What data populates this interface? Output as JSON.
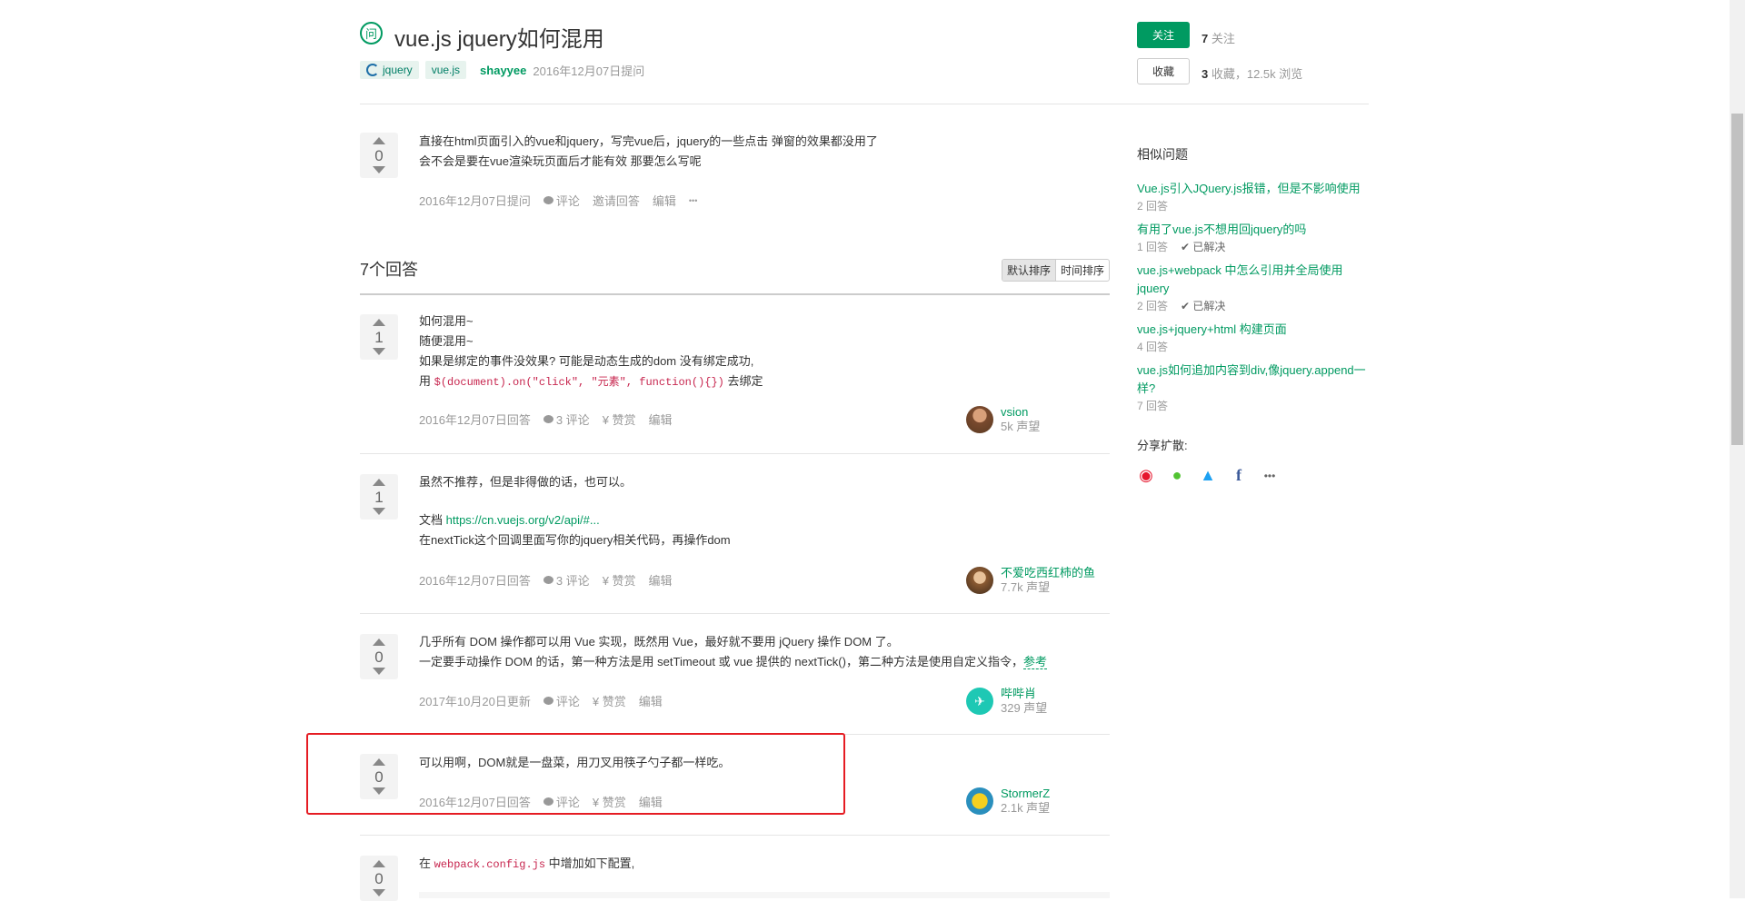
{
  "question": {
    "icon_text": "问",
    "title": "vue.js jquery如何混用",
    "tags": [
      "jquery",
      "vue.js"
    ],
    "author": "shayyee",
    "asked_time": "2016年12月07日提问",
    "follow_label": "关注",
    "follow_count": "7",
    "follow_suffix": " 关注",
    "collect_label": "收藏",
    "collect_count": "3",
    "collect_suffix": " 收藏，12.5k 浏览",
    "votes": "0",
    "body_line1": "直接在html页面引入的vue和jquery，写完vue后，jquery的一些点击 弹窗的效果都没用了",
    "body_line2": "会不会是要在vue渲染玩页面后才能有效 那要怎么写呢",
    "action_time": "2016年12月07日提问",
    "action_comment": "评论",
    "action_invite": "邀请回答",
    "action_edit": "编辑",
    "action_more": "•••"
  },
  "answers_header": {
    "title": "7个回答",
    "sort_default": "默认排序",
    "sort_time": "时间排序"
  },
  "answers": [
    {
      "votes": "1",
      "line1": "如何混用~",
      "line2": "随便混用~",
      "line3": "如果是绑定的事件没效果? 可能是动态生成的dom 没有绑定成功,",
      "line4_prefix": "用 ",
      "line4_code": "$(document).on(\"click\", \"元素\", function(){})",
      "line4_suffix": " 去绑定",
      "time": "2016年12月07日回答",
      "comments": "3 评论",
      "reward": "¥ 赞赏",
      "edit": "编辑",
      "user": "vsion",
      "rep": "5k 声望"
    },
    {
      "votes": "1",
      "line1": "虽然不推荐，但是非得做的话，也可以。",
      "line2_prefix": "文档 ",
      "line2_link": "https://cn.vuejs.org/v2/api/#...",
      "line3": "在nextTick这个回调里面写你的jquery相关代码，再操作dom",
      "time": "2016年12月07日回答",
      "comments": "3 评论",
      "reward": "¥ 赞赏",
      "edit": "编辑",
      "user": "不爱吃西红柿的鱼",
      "rep": "7.7k 声望"
    },
    {
      "votes": "0",
      "line1": "几乎所有 DOM 操作都可以用 Vue 实现，既然用 Vue，最好就不要用 jQuery 操作 DOM 了。",
      "line2": "一定要手动操作 DOM 的话，第一种方法是用 setTimeout 或 vue 提供的 nextTick()，第二种方法是使用自定义指令，",
      "line2_link": "参考",
      "time": "2017年10月20日更新",
      "comments": "评论",
      "reward": "¥ 赞赏",
      "edit": "编辑",
      "user": "哔哔肖",
      "rep": "329 声望"
    },
    {
      "votes": "0",
      "line1": "可以用啊，DOM就是一盘菜，用刀叉用筷子勺子都一样吃。",
      "time": "2016年12月07日回答",
      "comments": "评论",
      "reward": "¥ 赞赏",
      "edit": "编辑",
      "user": "StormerZ",
      "rep": "2.1k 声望"
    },
    {
      "votes": "0",
      "line1_prefix": "在 ",
      "line1_code": "webpack.config.js",
      "line1_suffix": " 中增加如下配置,"
    }
  ],
  "sidebar": {
    "similar_title": "相似问题",
    "similar": [
      {
        "title": "Vue.js引入JQuery.js报错，但是不影响使用",
        "answers": "2 回答",
        "solved": ""
      },
      {
        "title": "有用了vue.js不想用回jquery的吗",
        "answers": "1 回答",
        "solved": "✔ 已解决"
      },
      {
        "title": "vue.js+webpack 中怎么引用并全局使用jquery",
        "answers": "2 回答",
        "solved": "✔ 已解决"
      },
      {
        "title": "vue.js+jquery+html 构建页面",
        "answers": "4 回答",
        "solved": ""
      },
      {
        "title": "vue.js如何追加内容到div,像jquery.append一样?",
        "answers": "7 回答",
        "solved": ""
      }
    ],
    "share_title": "分享扩散:",
    "share_icons": [
      "weibo-icon",
      "wechat-icon",
      "twitter-icon",
      "facebook-icon",
      "more-icon"
    ]
  }
}
